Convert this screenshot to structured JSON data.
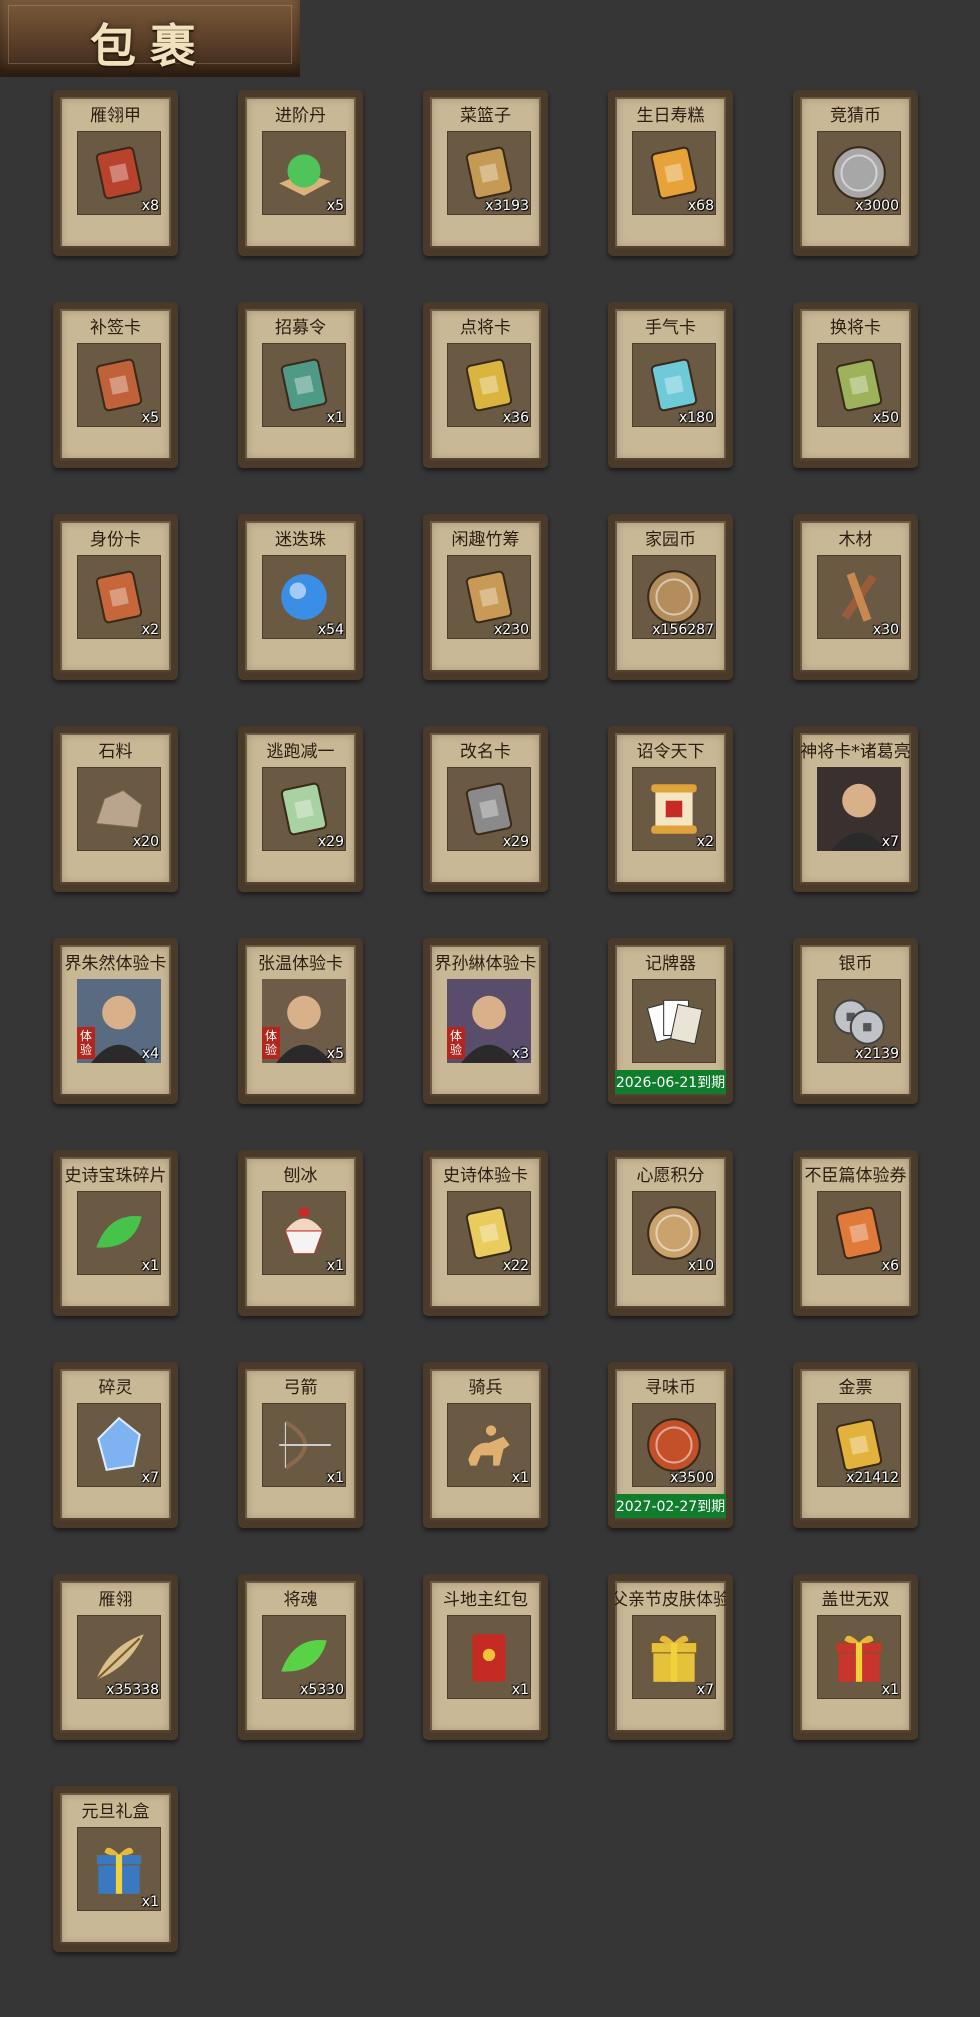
{
  "header": {
    "title": "包裹"
  },
  "items": [
    {
      "name": "雁翎甲",
      "count": "x8",
      "icon": "armor-icon",
      "color": "#b8422c"
    },
    {
      "name": "进阶丹",
      "count": "x5",
      "icon": "green-pill-icon",
      "color": "#4fc45a"
    },
    {
      "name": "菜篮子",
      "count": "x3193",
      "icon": "basket-icon",
      "color": "#c49a54"
    },
    {
      "name": "生日寿糕",
      "count": "x68",
      "icon": "cake-icon",
      "color": "#e7a23a"
    },
    {
      "name": "竞猜币",
      "count": "x3000",
      "icon": "silver-coin-icon",
      "color": "#a7a7a7"
    },
    {
      "name": "补签卡",
      "count": "x5",
      "icon": "tag-card-icon",
      "color": "#c0613a"
    },
    {
      "name": "招募令",
      "count": "x1",
      "icon": "recruit-token-icon",
      "color": "#4f9a86"
    },
    {
      "name": "点将卡",
      "count": "x36",
      "icon": "general-card-icon",
      "color": "#d9b540"
    },
    {
      "name": "手气卡",
      "count": "x180",
      "icon": "luck-card-icon",
      "color": "#6ec9d8"
    },
    {
      "name": "换将卡",
      "count": "x50",
      "icon": "swap-card-icon",
      "color": "#9cb35b"
    },
    {
      "name": "身份卡",
      "count": "x2",
      "icon": "identity-card-icon",
      "color": "#c7663a"
    },
    {
      "name": "迷迭珠",
      "count": "x54",
      "icon": "blue-orb-icon",
      "color": "#3a8ee6"
    },
    {
      "name": "闲趣竹筹",
      "count": "x230",
      "icon": "bamboo-tally-icon",
      "color": "#c89a55"
    },
    {
      "name": "家园币",
      "count": "x156287",
      "icon": "bronze-coin-icon",
      "color": "#b48d5c"
    },
    {
      "name": "木材",
      "count": "x30",
      "icon": "wood-icon",
      "color": "#9a5b3a"
    },
    {
      "name": "石料",
      "count": "x20",
      "icon": "stone-icon",
      "color": "#b9a58d"
    },
    {
      "name": "逃跑减一",
      "count": "x29",
      "icon": "jade-tag-icon",
      "color": "#a9d2a2"
    },
    {
      "name": "改名卡",
      "count": "x29",
      "icon": "rename-tag-icon",
      "color": "#8a8a8a"
    },
    {
      "name": "诏令天下",
      "count": "x2",
      "icon": "scroll-icon",
      "color": "#e0a23a"
    },
    {
      "name": "神将卡*诸葛亮",
      "count": "x7",
      "icon": "portrait-icon",
      "color": "#3b3030",
      "portrait": true
    },
    {
      "name": "界朱然体验卡",
      "count": "x4",
      "icon": "portrait-icon",
      "color": "#596b80",
      "portrait": true,
      "tiyan": "体验"
    },
    {
      "name": "张温体验卡",
      "count": "x5",
      "icon": "portrait-icon",
      "color": "#6e5c48",
      "portrait": true,
      "tiyan": "体验"
    },
    {
      "name": "界孙綝体验卡",
      "count": "x3",
      "icon": "portrait-icon",
      "color": "#5a4d6b",
      "portrait": true,
      "tiyan": "体验"
    },
    {
      "name": "记牌器",
      "count": "",
      "icon": "playing-cards-icon",
      "color": "#e9e4d6",
      "expiry": "2026-06-21到期"
    },
    {
      "name": "银币",
      "count": "x2139",
      "icon": "silver-coins-icon",
      "color": "#bfc3c7"
    },
    {
      "name": "史诗宝珠碎片",
      "count": "x1",
      "icon": "leaf-shard-icon",
      "color": "#47c24a"
    },
    {
      "name": "刨冰",
      "count": "x1",
      "icon": "shaved-ice-icon",
      "color": "#f2d5c5"
    },
    {
      "name": "史诗体验卡",
      "count": "x22",
      "icon": "gold-card-icon",
      "color": "#e9cc5d"
    },
    {
      "name": "心愿积分",
      "count": "x10",
      "icon": "heart-coin-icon",
      "color": "#c9a26e"
    },
    {
      "name": "不臣篇体验券",
      "count": "x6",
      "icon": "ticket-icon",
      "color": "#e07a3a"
    },
    {
      "name": "碎灵",
      "count": "x7",
      "icon": "crystal-icon",
      "color": "#7fb2f0"
    },
    {
      "name": "弓箭",
      "count": "x1",
      "icon": "bow-icon",
      "color": "#8a6a4a"
    },
    {
      "name": "骑兵",
      "count": "x1",
      "icon": "cavalry-icon",
      "color": "#e0b070"
    },
    {
      "name": "寻味币",
      "count": "",
      "icon": "flavor-coin-icon",
      "color": "#c4502a",
      "expiry": "2027-02-27到期",
      "extra_count": "x3500"
    },
    {
      "name": "金票",
      "count": "x21412",
      "icon": "gold-ticket-icon",
      "color": "#e3b23c"
    },
    {
      "name": "雁翎",
      "count": "x35338",
      "icon": "feather-icon",
      "color": "#d9c08a"
    },
    {
      "name": "将魂",
      "count": "x5330",
      "icon": "soul-crystal-icon",
      "color": "#5ad246"
    },
    {
      "name": "斗地主红包",
      "count": "x1",
      "icon": "red-envelope-icon",
      "color": "#c62a24"
    },
    {
      "name": "父亲节皮肤体验包",
      "count": "x7",
      "icon": "gift-box-icon",
      "color": "#e6c23a"
    },
    {
      "name": "盖世无双",
      "count": "x1",
      "icon": "red-gift-icon",
      "color": "#c7352c"
    },
    {
      "name": "元旦礼盒",
      "count": "x1",
      "icon": "blue-gift-icon",
      "color": "#3a78c2"
    }
  ]
}
